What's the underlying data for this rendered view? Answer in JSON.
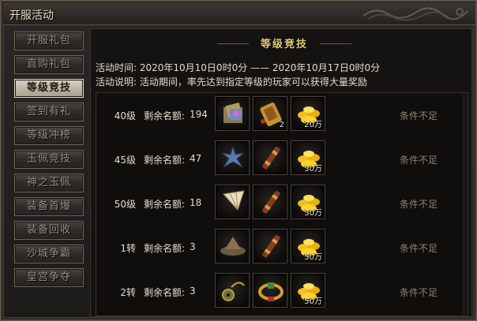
{
  "window": {
    "title": "开服活动"
  },
  "sidebar": {
    "items": [
      {
        "label": "开服礼包",
        "active": false
      },
      {
        "label": "直购礼包",
        "active": false
      },
      {
        "label": "等级竞技",
        "active": true
      },
      {
        "label": "签到有礼",
        "active": false
      },
      {
        "label": "等级冲榜",
        "active": false
      },
      {
        "label": "玉佩竞技",
        "active": false
      },
      {
        "label": "神之玉佩",
        "active": false
      },
      {
        "label": "装备首爆",
        "active": false
      },
      {
        "label": "装备回收",
        "active": false
      },
      {
        "label": "沙城争霸",
        "active": false
      },
      {
        "label": "皇宫争夺",
        "active": false
      }
    ]
  },
  "main": {
    "banner": "等级竞技",
    "time_line": "活动时间: 2020年10月10日0时0分  ——  2020年10月17日0时0分",
    "desc_line": "活动说明: 活动期间，率先达到指定等级的玩家可以获得大量奖励",
    "quota_label": "剩余名额:",
    "rows": [
      {
        "level": "40级",
        "quota": "194",
        "status": "条件不足",
        "rewards": [
          {
            "icon": "gift-bundle-icon",
            "qty": ""
          },
          {
            "icon": "gold-token-icon",
            "qty": "2"
          },
          {
            "icon": "gold-ingot-icon",
            "qty": "20万"
          }
        ]
      },
      {
        "level": "45级",
        "quota": "47",
        "status": "条件不足",
        "rewards": [
          {
            "icon": "blue-flower-icon",
            "qty": ""
          },
          {
            "icon": "scroll-icon",
            "qty": ""
          },
          {
            "icon": "gold-ingot-icon",
            "qty": "30万"
          }
        ]
      },
      {
        "level": "50级",
        "quota": "18",
        "status": "条件不足",
        "rewards": [
          {
            "icon": "folding-fan-icon",
            "qty": ""
          },
          {
            "icon": "scroll-icon",
            "qty": ""
          },
          {
            "icon": "gold-ingot-icon",
            "qty": "30万"
          }
        ]
      },
      {
        "level": "1转",
        "quota": "3",
        "status": "条件不足",
        "rewards": [
          {
            "icon": "straw-hat-icon",
            "qty": ""
          },
          {
            "icon": "scroll-icon",
            "qty": ""
          },
          {
            "icon": "gold-ingot-icon",
            "qty": "50万"
          }
        ]
      },
      {
        "level": "2转",
        "quota": "3",
        "status": "条件不足",
        "rewards": [
          {
            "icon": "jade-pendant-icon",
            "qty": ""
          },
          {
            "icon": "gold-belt-icon",
            "qty": ""
          },
          {
            "icon": "gold-ingot-icon",
            "qty": "50万"
          }
        ]
      }
    ]
  },
  "colors": {
    "accent": "#e8c878",
    "text": "#e4dccc",
    "status": "#8c8272"
  }
}
